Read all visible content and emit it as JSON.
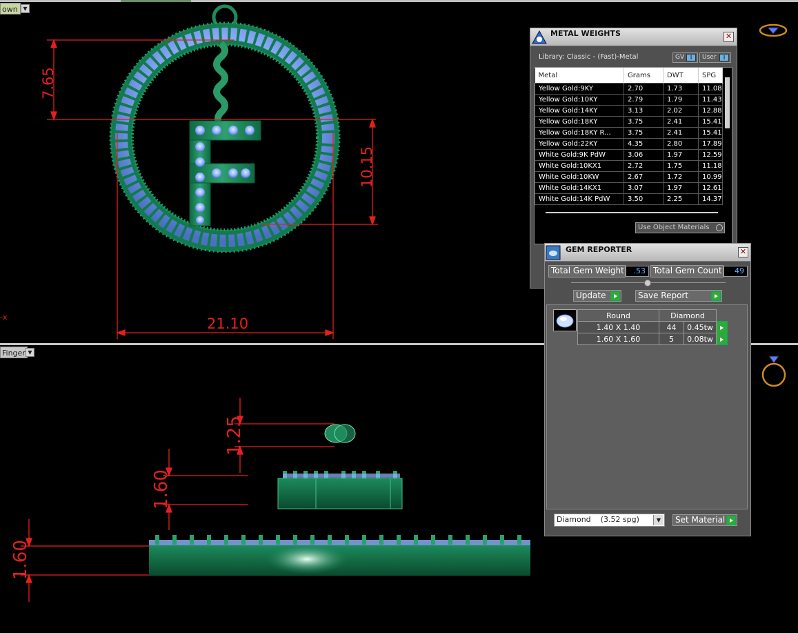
{
  "top_viewport": {
    "label": "own",
    "axis_label": "-x"
  },
  "bottom_viewport": {
    "label": "Finger"
  },
  "dimensions": {
    "top": [
      "7.65",
      "10.15",
      "21.10"
    ],
    "bottom": [
      "1.25",
      "1.60",
      "1.60"
    ]
  },
  "metal_weights": {
    "title": "METAL WEIGHTS",
    "library": "Library: Classic - (Fast)-Metal",
    "gv_label": "GV",
    "user_label": "User",
    "columns": [
      "Metal",
      "Grams",
      "DWT",
      "SPG"
    ],
    "rows": [
      [
        "Yellow Gold:9KY",
        "2.70",
        "1.73",
        "11.08"
      ],
      [
        "Yellow Gold:10KY",
        "2.79",
        "1.79",
        "11.43"
      ],
      [
        "Yellow Gold:14KY",
        "3.13",
        "2.02",
        "12.88"
      ],
      [
        "Yellow Gold:18KY",
        "3.75",
        "2.41",
        "15.41"
      ],
      [
        "Yellow Gold:18KY R...",
        "3.75",
        "2.41",
        "15.41"
      ],
      [
        "Yellow Gold:22KY",
        "4.35",
        "2.80",
        "17.89"
      ],
      [
        "White Gold:9K PdW",
        "3.06",
        "1.97",
        "12.59"
      ],
      [
        "White Gold:10KX1",
        "2.72",
        "1.75",
        "11.18"
      ],
      [
        "White Gold:10KW",
        "2.67",
        "1.72",
        "10.99"
      ],
      [
        "White Gold:14KX1",
        "3.07",
        "1.97",
        "12.61"
      ],
      [
        "White Gold:14K PdW",
        "3.50",
        "2.25",
        "14.37"
      ]
    ],
    "use_object_materials": "Use Object Materials"
  },
  "gem_reporter": {
    "title": "GEM REPORTER",
    "total_weight_label": "Total Gem Weight",
    "total_weight_value": ".53",
    "total_count_label": "Total Gem Count",
    "total_count_value": "49",
    "update_label": "Update",
    "save_report_label": "Save Report",
    "headers": [
      "Round",
      "Diamond"
    ],
    "rows": [
      [
        "1.40 X 1.40",
        "44",
        "0.45tw"
      ],
      [
        "1.60 X 1.60",
        "5",
        "0.08tw"
      ]
    ],
    "material_select": "Diamond    (3.52 spg)",
    "set_material_label": "Set Material"
  },
  "icons": {
    "top_right": "diamond-ring-top-icon",
    "bottom_right": "ring-side-icon",
    "gem": "gem-thumbnail-icon"
  },
  "colors": {
    "dimension_red": "#e32020",
    "metal_green": "#1f8a5c",
    "stone_blue": "#8fb8ff",
    "accent_green_button": "#2faa3a"
  }
}
